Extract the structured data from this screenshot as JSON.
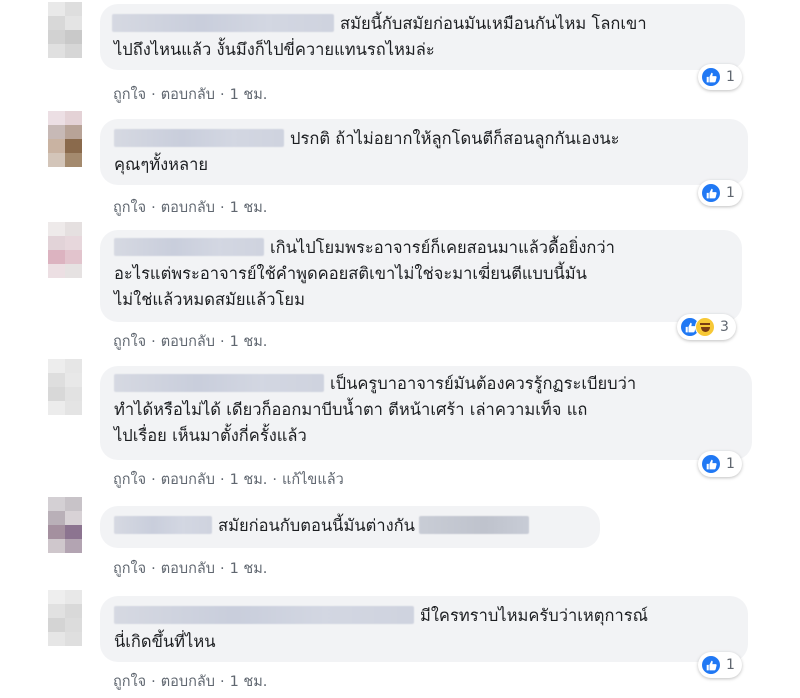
{
  "actions": {
    "like": "ถูกใจ",
    "reply": "ตอบกลับ",
    "dot": "·"
  },
  "colors": {
    "like_blue": "#2078f4",
    "bubble": "#f2f3f5",
    "meta": "#606770"
  },
  "comments": [
    {
      "lines": [
        "สมัยนี้กับสมัยก่อนมันเหมือนกันไหม โลกเขา",
        "ไปถึงไหนแล้ว งั้นมึงก็ไปขี่ควายแทนรถไหมล่ะ"
      ],
      "time": "1 ชม.",
      "reaction_icons": [
        "like-icon"
      ],
      "reaction_count": "1"
    },
    {
      "lines": [
        "ปรกติ ถ้าไม่อยากให้ลูกโดนตีก็สอนลูกกันเองนะ",
        "คุณๆทั้งหลาย"
      ],
      "time": "1 ชม.",
      "reaction_icons": [
        "like-icon"
      ],
      "reaction_count": "1"
    },
    {
      "lines": [
        "เกินไปโยมพระอาจารย์ก็เคยสอนมาแล้วดื้อยิ่งกว่า",
        "อะไรแต่พระอาจารย์ใช้คำพูดคอยสติเขาไม่ใช่จะมาเฆี่ยนตีแบบนี้มัน",
        "ไม่ใช่แล้วหมดสมัยแล้วโยม"
      ],
      "time": "1 ชม.",
      "reaction_icons": [
        "like-icon",
        "haha-icon"
      ],
      "reaction_count": "3"
    },
    {
      "lines": [
        "เป็นครูบาอาจารย์มันต้องควรรู้กฏระเบียบว่า",
        "ทำได้หรือไม่ได้ เดียวก็ออกมาบีบน้ำตา ตีหน้าเศร้า เล่าความเท็จ แถ",
        "ไปเรื่อย เห็นมาตั้งกี่ครั้งแล้ว"
      ],
      "time": "1 ชม.",
      "edited": "แก้ไขแล้ว",
      "reaction_icons": [
        "like-icon"
      ],
      "reaction_count": "1"
    },
    {
      "lines": [
        "สมัยก่อนกับตอนนี้มันต่างกัน"
      ],
      "time": "1 ชม."
    },
    {
      "lines": [
        "มีใครทราบไหมครับว่าเหตุการณ์",
        "นี่เกิดขึ้นที่ไหน"
      ],
      "time": "1 ชม.",
      "reaction_icons": [
        "like-icon"
      ],
      "reaction_count": "1"
    }
  ]
}
